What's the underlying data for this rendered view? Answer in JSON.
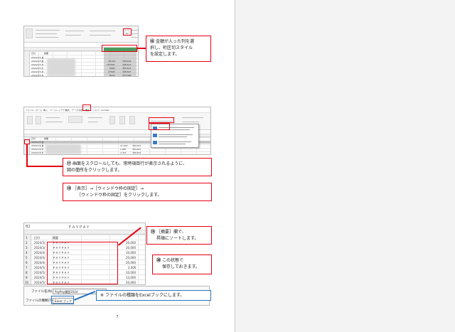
{
  "steps": {
    "s16": {
      "num": "⑯",
      "text_1": "金額が入った列を選",
      "text_2": "択し、桁区切スタイル",
      "text_3": "を設定します。"
    },
    "s17": {
      "num": "⑰",
      "text_1": "画面をスクロールしても、常時項目行が表示されるように、",
      "text_2": "図の箇所をクリックします。"
    },
    "s18": {
      "num": "⑱",
      "text_1": "［表示］→［ウィンドウ枠の固定］→",
      "text_2": "［ウィンドウ枠の固定］をクリックします。"
    },
    "s19": {
      "num": "⑲",
      "text_1": "［摘要］欄で、",
      "text_2": "昇順にソートします。"
    },
    "s20": {
      "num": "⑳",
      "text_1": "この状態で",
      "text_2": "保存しておきます。"
    },
    "note": {
      "mark": "※",
      "text": "ファイルの種類をExcelブックにします。"
    }
  },
  "shot1": {
    "header_date": "日付",
    "header_summary": "摘要",
    "dates": [
      "2024/1/5 金",
      "2024/1/5 金",
      "2024/1/5 木",
      "2024/1/5 木",
      "2024/1/5 木",
      "2024/1/5 木"
    ],
    "values": [
      "78,032",
      "167000",
      "2860",
      "17620",
      "8022"
    ],
    "values_b": [
      "308,844",
      "348,612",
      "350,612",
      "308,647",
      "373,066"
    ]
  },
  "shot2": {
    "menus": [
      "ファイル",
      "ホーム",
      "挿入",
      "ページレイアウト",
      "数式",
      "データ",
      "校閲",
      "表示",
      "ヘルプ",
      "Acrobat"
    ],
    "active_menu": "表示",
    "header_date": "日付",
    "header_summary": "摘要",
    "dates": [
      "2024/1/5 金",
      "2024/1/5 金",
      "2024/1/5 木",
      "2024/1/5 木",
      "2024/1/5 木"
    ],
    "freeze_button": "ウィンドウ枠の固定"
  },
  "shot3": {
    "cell_ref": "B2",
    "formula_text": "ＰＡＹＰＡＹ",
    "header_date": "日付",
    "header_summary": "摘要",
    "row_numbers": [
      "1",
      "2",
      "3",
      "4",
      "5",
      "6",
      "7",
      "8",
      "9",
      "10",
      "11"
    ],
    "dates": [
      "2024/3/",
      "2024/3/",
      "2024/4/",
      "2024/4/",
      "2024/4/",
      "2024/5/",
      "2024/5/",
      "2024/5/",
      "2024/5/",
      "2024/6/"
    ],
    "summaries": [
      "ＰＡＹＰＡＹ",
      "ＰＡＹＰＡＹ",
      "ＰＡＹＰＡＹ",
      "ＰＡＹＰＡＹ",
      "ＰＡＹＰＡＹ",
      "ＰＡＹＰＡＹ",
      "ＰＡＹＰＡＹ",
      "ＰＡＹＰＡＹ",
      "ＰＡＹＰＡＹ",
      "ＰＡＹＰＡＹ"
    ],
    "amounts": [
      "20,000",
      "20,000",
      "10,000",
      "20,000",
      "20,000",
      "2,000",
      "10,000",
      "13,000",
      "20,000",
      "10,000"
    ]
  },
  "save_dialog": {
    "filename_label": "ファイル名(N):",
    "filename_value": "PayPay履歴2024",
    "filetype_label": "ファイルの種類(T):",
    "filetype_value": "Excel ブック"
  },
  "page_number": "7",
  "colors": {
    "callout_red": "#e60012",
    "callout_blue": "#2a74c4",
    "selection_green": "#4c9a5c"
  }
}
